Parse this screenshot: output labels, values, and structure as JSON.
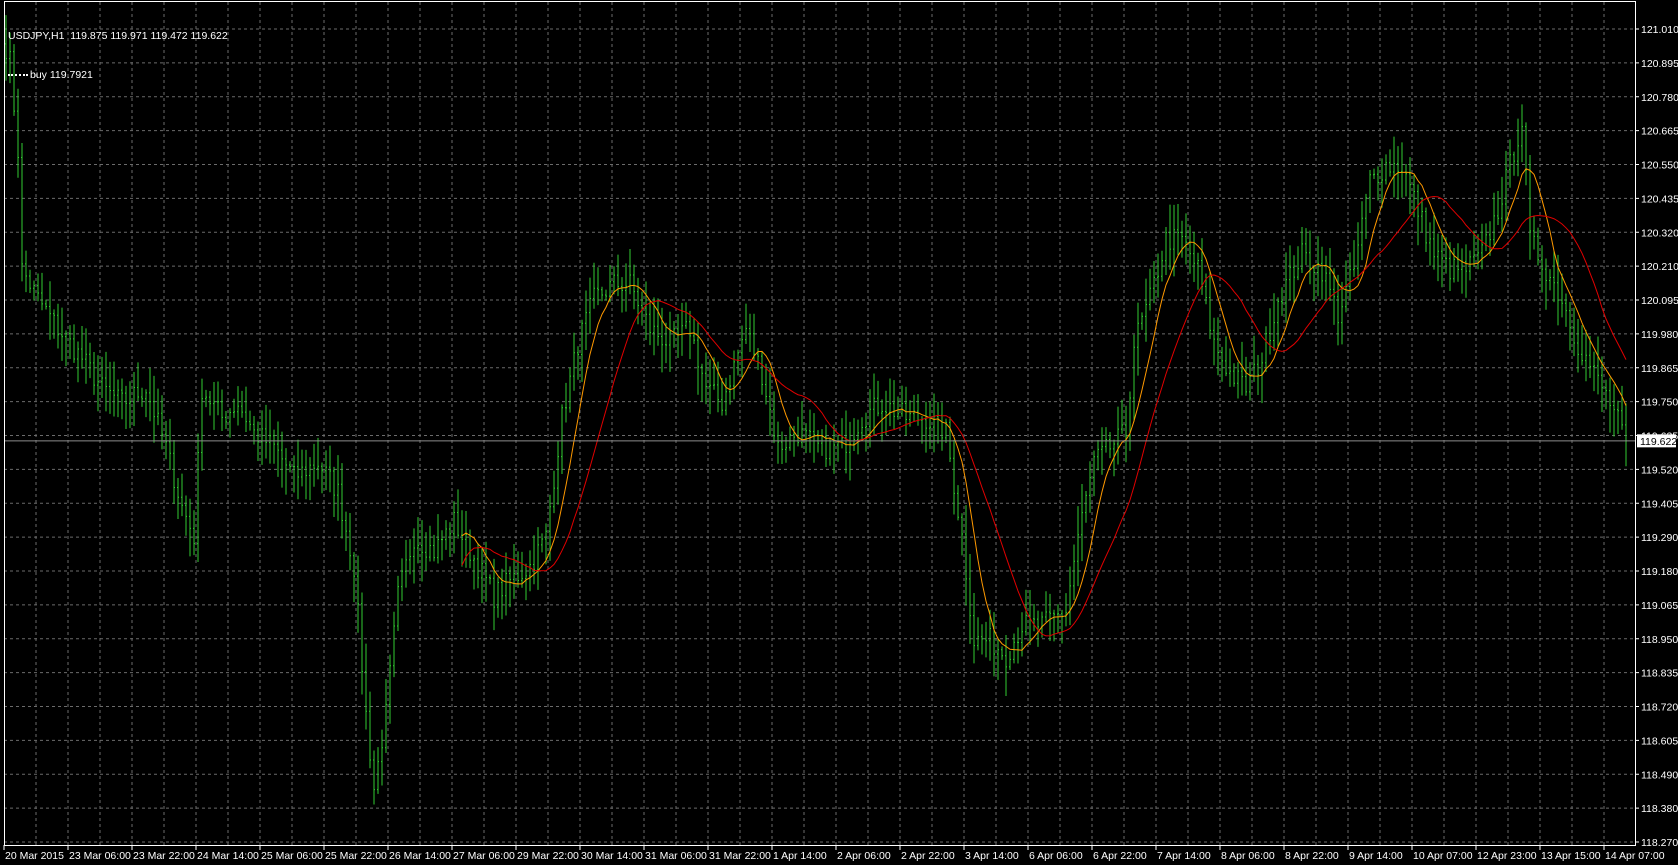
{
  "legend": {
    "symbol": "USDJPY,H1",
    "ohlc": "119.875 119.971 119.472 119.622",
    "buy_label": "buy 119.7921"
  },
  "colors": {
    "background": "#000000",
    "bars": "#32cd32",
    "grid": "#6b6b6b",
    "fast_ma": "#ff9900",
    "slow_ma": "#e00000",
    "axis": "#ffffff"
  },
  "chart_data": {
    "type": "ohlc-bar",
    "symbol": "USDJPY",
    "timeframe": "H1",
    "ylim": [
      118.27,
      121.01
    ],
    "current_price": 119.622,
    "price_ticks": [
      "121.010",
      "120.895",
      "120.780",
      "120.665",
      "120.550",
      "120.435",
      "120.320",
      "120.210",
      "120.095",
      "119.980",
      "119.865",
      "119.750",
      "119.635",
      "119.520",
      "119.405",
      "119.290",
      "119.180",
      "119.065",
      "118.950",
      "118.835",
      "118.720",
      "118.605",
      "118.490",
      "118.380",
      "118.270"
    ],
    "time_ticks": [
      "20 Mar 2015",
      "23 Mar 06:00",
      "23 Mar 22:00",
      "24 Mar 14:00",
      "25 Mar 06:00",
      "25 Mar 22:00",
      "26 Mar 14:00",
      "27 Mar 06:00",
      "29 Mar 22:00",
      "30 Mar 14:00",
      "31 Mar 06:00",
      "31 Mar 22:00",
      "1 Apr 14:00",
      "2 Apr 06:00",
      "2 Apr 22:00",
      "3 Apr 14:00",
      "6 Apr 06:00",
      "6 Apr 22:00",
      "7 Apr 14:00",
      "8 Apr 06:00",
      "8 Apr 22:00",
      "9 Apr 14:00",
      "10 Apr 07:00",
      "12 Apr 23:00",
      "13 Apr 15:00",
      "14 Apr 07:00"
    ],
    "bars_per_time_tick": 16,
    "close_keypoints": [
      [
        0,
        120.95
      ],
      [
        1,
        120.9
      ],
      [
        3,
        120.6
      ],
      [
        4,
        120.2
      ],
      [
        8,
        120.1
      ],
      [
        13,
        120.0
      ],
      [
        19,
        119.9
      ],
      [
        24,
        119.8
      ],
      [
        29,
        119.75
      ],
      [
        35,
        119.8
      ],
      [
        40,
        119.6
      ],
      [
        44,
        119.4
      ],
      [
        47,
        119.3
      ],
      [
        49,
        119.8
      ],
      [
        54,
        119.7
      ],
      [
        58,
        119.75
      ],
      [
        62,
        119.65
      ],
      [
        67,
        119.6
      ],
      [
        72,
        119.5
      ],
      [
        78,
        119.55
      ],
      [
        83,
        119.45
      ],
      [
        87,
        119.2
      ],
      [
        90,
        118.7
      ],
      [
        92,
        118.45
      ],
      [
        95,
        118.7
      ],
      [
        98,
        119.1
      ],
      [
        102,
        119.3
      ],
      [
        107,
        119.25
      ],
      [
        112,
        119.35
      ],
      [
        118,
        119.2
      ],
      [
        122,
        119.1
      ],
      [
        126,
        119.15
      ],
      [
        131,
        119.2
      ],
      [
        135,
        119.3
      ],
      [
        139,
        119.7
      ],
      [
        143,
        119.95
      ],
      [
        147,
        120.1
      ],
      [
        152,
        120.15
      ],
      [
        156,
        120.15
      ],
      [
        161,
        120.0
      ],
      [
        166,
        119.95
      ],
      [
        171,
        120.0
      ],
      [
        175,
        119.8
      ],
      [
        179,
        119.75
      ],
      [
        185,
        120.0
      ],
      [
        189,
        119.85
      ],
      [
        193,
        119.6
      ],
      [
        198,
        119.65
      ],
      [
        203,
        119.6
      ],
      [
        209,
        119.6
      ],
      [
        214,
        119.7
      ],
      [
        219,
        119.75
      ],
      [
        225,
        119.7
      ],
      [
        230,
        119.7
      ],
      [
        235,
        119.65
      ],
      [
        239,
        119.3
      ],
      [
        242,
        118.95
      ],
      [
        246,
        118.95
      ],
      [
        250,
        118.9
      ],
      [
        254,
        119.0
      ],
      [
        259,
        119.0
      ],
      [
        265,
        119.05
      ],
      [
        268,
        119.3
      ],
      [
        272,
        119.55
      ],
      [
        276,
        119.6
      ],
      [
        280,
        119.65
      ],
      [
        282,
        119.95
      ],
      [
        286,
        120.1
      ],
      [
        290,
        120.3
      ],
      [
        294,
        120.3
      ],
      [
        298,
        120.2
      ],
      [
        302,
        119.95
      ],
      [
        306,
        119.85
      ],
      [
        310,
        119.8
      ],
      [
        314,
        119.9
      ],
      [
        318,
        120.1
      ],
      [
        324,
        120.25
      ],
      [
        329,
        120.2
      ],
      [
        333,
        120.05
      ],
      [
        337,
        120.2
      ],
      [
        341,
        120.5
      ],
      [
        345,
        120.55
      ],
      [
        349,
        120.55
      ],
      [
        353,
        120.4
      ],
      [
        357,
        120.25
      ],
      [
        361,
        120.2
      ],
      [
        365,
        120.2
      ],
      [
        369,
        120.25
      ],
      [
        373,
        120.4
      ],
      [
        376,
        120.55
      ],
      [
        379,
        120.7
      ],
      [
        381,
        120.3
      ],
      [
        385,
        120.2
      ],
      [
        389,
        120.1
      ],
      [
        393,
        119.95
      ],
      [
        397,
        119.85
      ],
      [
        401,
        119.75
      ],
      [
        405,
        119.622
      ]
    ],
    "indicators": [
      {
        "name": "fast moving average",
        "period": 8,
        "color": "#ff9900",
        "start_bar": 114
      },
      {
        "name": "slow moving average",
        "period": 20,
        "color": "#e00000",
        "start_bar": 114
      }
    ],
    "grid": true
  }
}
